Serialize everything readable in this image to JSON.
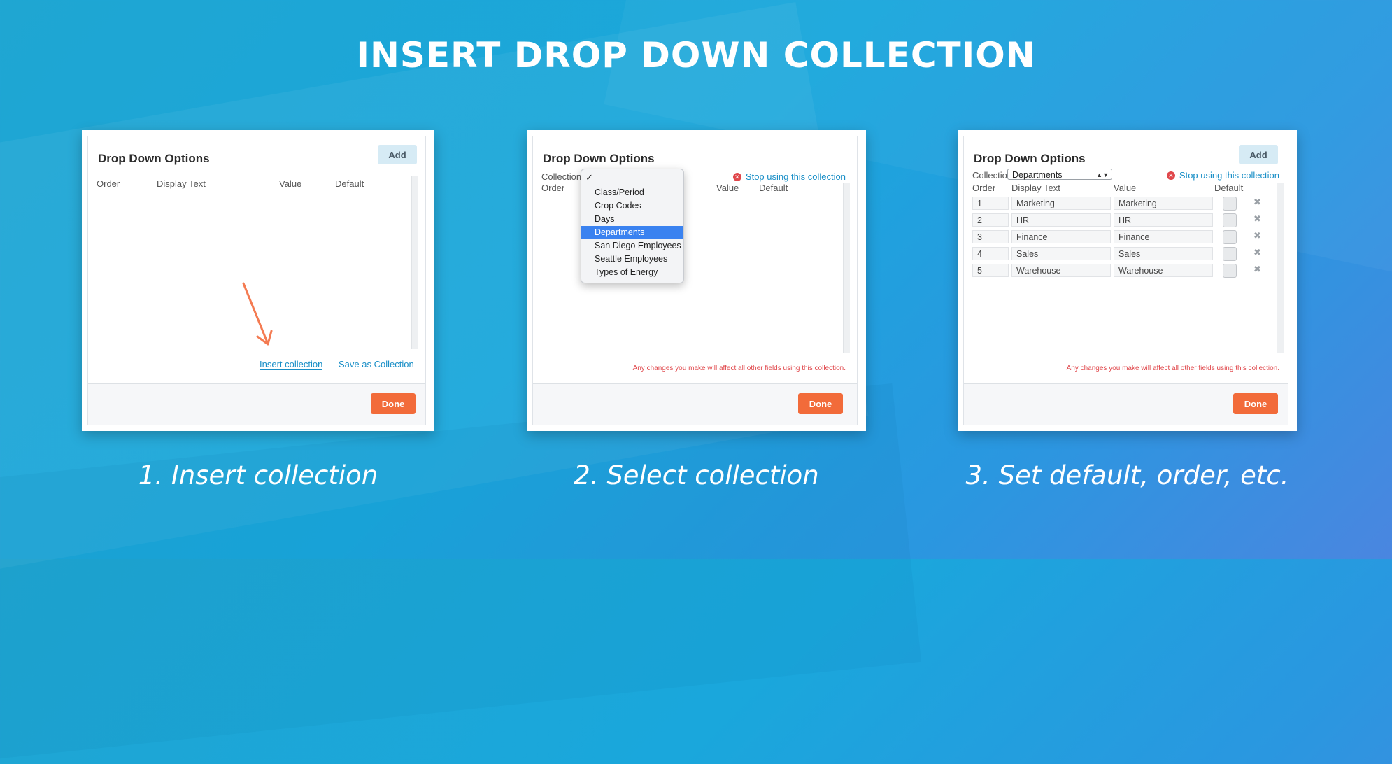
{
  "headline": "INSERT DROP DOWN COLLECTION",
  "captions": [
    "1. Insert collection",
    "2. Select collection",
    "3. Set default, order, etc."
  ],
  "panel": {
    "title": "Drop Down Options",
    "add_label": "Add",
    "done_label": "Done",
    "columns": {
      "order": "Order",
      "display_text": "Display Text",
      "value": "Value",
      "default": "Default"
    }
  },
  "shot1": {
    "insert_link": "Insert collection",
    "save_link": "Save as Collection",
    "arrow_color": "#f47b52"
  },
  "shot2": {
    "collection_label": "Collection",
    "stop_link": "Stop using this collection",
    "warning": "Any changes you make will affect all other fields using this collection.",
    "menu_items": [
      "Class/Period",
      "Crop Codes",
      "Days",
      "Departments",
      "San Diego Employees",
      "Seattle Employees",
      "Types of Energy"
    ],
    "selected_item": "Departments"
  },
  "shot3": {
    "collection_label": "Collection:",
    "collection_value": "Departments",
    "stop_link": "Stop using this collection",
    "warning": "Any changes you make will affect all other fields using this collection.",
    "rows": [
      {
        "order": "1",
        "display": "Marketing",
        "value": "Marketing"
      },
      {
        "order": "2",
        "display": "HR",
        "value": "HR"
      },
      {
        "order": "3",
        "display": "Finance",
        "value": "Finance"
      },
      {
        "order": "4",
        "display": "Sales",
        "value": "Sales"
      },
      {
        "order": "5",
        "display": "Warehouse",
        "value": "Warehouse"
      }
    ]
  },
  "colors": {
    "accent": "#f26b3a",
    "link": "#1a8fc7",
    "warning": "#e0474b",
    "selected": "#3a82f0"
  }
}
